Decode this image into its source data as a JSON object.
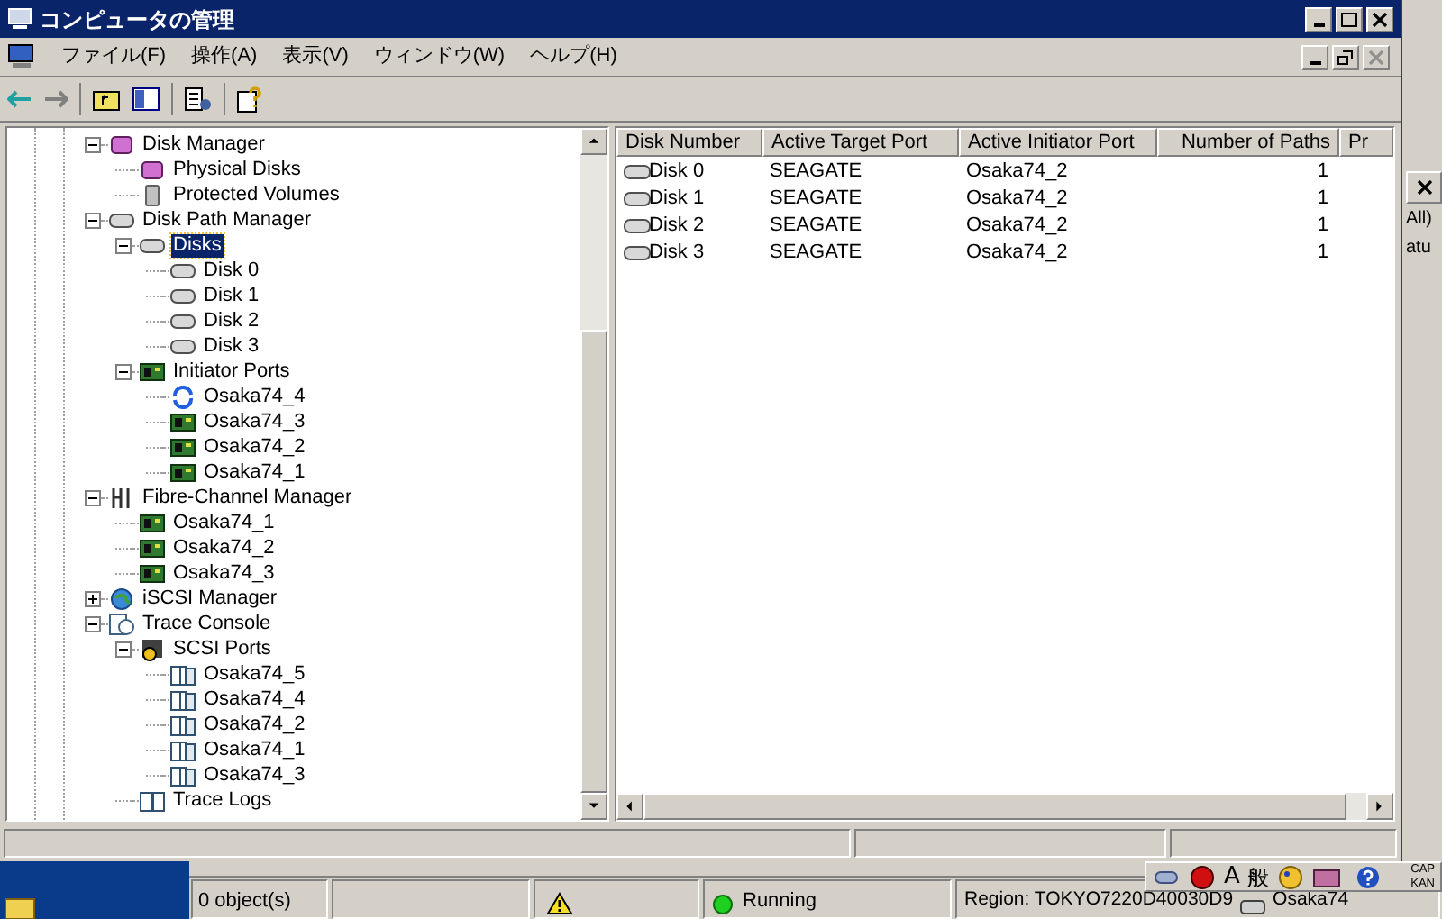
{
  "window": {
    "title": "コンピュータの管理"
  },
  "menu": [
    "ファイル(F)",
    "操作(A)",
    "表示(V)",
    "ウィンドウ(W)",
    "ヘルプ(H)"
  ],
  "tree": {
    "items": [
      {
        "label": "Disk Manager",
        "kind": "disk-manager",
        "expanded": true,
        "selected": false,
        "children": [
          {
            "label": "Physical Disks",
            "kind": "disk-manager",
            "selected": false
          },
          {
            "label": "Protected Volumes",
            "kind": "volume",
            "selected": false
          }
        ]
      },
      {
        "label": "Disk Path Manager",
        "kind": "disk",
        "expanded": true,
        "selected": false,
        "children": [
          {
            "label": "Disks",
            "kind": "disk",
            "expanded": true,
            "selected": true,
            "children": [
              {
                "label": "Disk 0",
                "kind": "disk",
                "selected": false
              },
              {
                "label": "Disk 1",
                "kind": "disk",
                "selected": false
              },
              {
                "label": "Disk 2",
                "kind": "disk",
                "selected": false
              },
              {
                "label": "Disk 3",
                "kind": "disk",
                "selected": false
              }
            ]
          },
          {
            "label": "Initiator Ports",
            "kind": "port",
            "expanded": true,
            "selected": false,
            "children": [
              {
                "label": "Osaka74_4",
                "kind": "port-sync",
                "selected": false
              },
              {
                "label": "Osaka74_3",
                "kind": "port",
                "selected": false
              },
              {
                "label": "Osaka74_2",
                "kind": "port",
                "selected": false
              },
              {
                "label": "Osaka74_1",
                "kind": "port",
                "selected": false
              }
            ]
          }
        ]
      },
      {
        "label": "Fibre-Channel Manager",
        "kind": "fibre",
        "expanded": true,
        "selected": false,
        "children": [
          {
            "label": "Osaka74_1",
            "kind": "port",
            "selected": false
          },
          {
            "label": "Osaka74_2",
            "kind": "port",
            "selected": false
          },
          {
            "label": "Osaka74_3",
            "kind": "port",
            "selected": false
          }
        ]
      },
      {
        "label": "iSCSI Manager",
        "kind": "globe",
        "expanded": false,
        "selected": false
      },
      {
        "label": "Trace Console",
        "kind": "trace",
        "expanded": true,
        "selected": false,
        "children": [
          {
            "label": "SCSI Ports",
            "kind": "scsi",
            "expanded": true,
            "selected": false,
            "children": [
              {
                "label": "Osaka74_5",
                "kind": "trace-port",
                "selected": false
              },
              {
                "label": "Osaka74_4",
                "kind": "trace-port",
                "selected": false
              },
              {
                "label": "Osaka74_2",
                "kind": "trace-port",
                "selected": false
              },
              {
                "label": "Osaka74_1",
                "kind": "trace-port",
                "selected": false
              },
              {
                "label": "Osaka74_3",
                "kind": "trace-port",
                "selected": false
              }
            ]
          },
          {
            "label": "Trace Logs",
            "kind": "book",
            "selected": false
          }
        ]
      }
    ]
  },
  "list": {
    "columns": [
      {
        "label": "Disk Number",
        "kind": "text"
      },
      {
        "label": "Active Target Port",
        "kind": "text"
      },
      {
        "label": "Active Initiator Port",
        "kind": "text"
      },
      {
        "label": "Number of Paths",
        "kind": "number"
      },
      {
        "label": "Pr",
        "kind": "text"
      }
    ],
    "rows": [
      {
        "cells": [
          "Disk 0",
          "SEAGATE",
          "Osaka74_2",
          "1"
        ]
      },
      {
        "cells": [
          "Disk 1",
          "SEAGATE",
          "Osaka74_2",
          "1"
        ]
      },
      {
        "cells": [
          "Disk 2",
          "SEAGATE",
          "Osaka74_2",
          "1"
        ]
      },
      {
        "cells": [
          "Disk 3",
          "SEAGATE",
          "Osaka74_2",
          "1"
        ]
      }
    ]
  },
  "background_window": {
    "fragments": [
      "All)",
      "atu"
    ]
  },
  "bottom_status": {
    "objects": "0 object(s)",
    "state": "Running",
    "region": "Region: TOKYO7220D40030D9",
    "host": "Osaka74"
  },
  "tray": {
    "ime_mode": "A",
    "ime_kanji": "般",
    "keys": [
      "CAP",
      "KAN"
    ]
  }
}
